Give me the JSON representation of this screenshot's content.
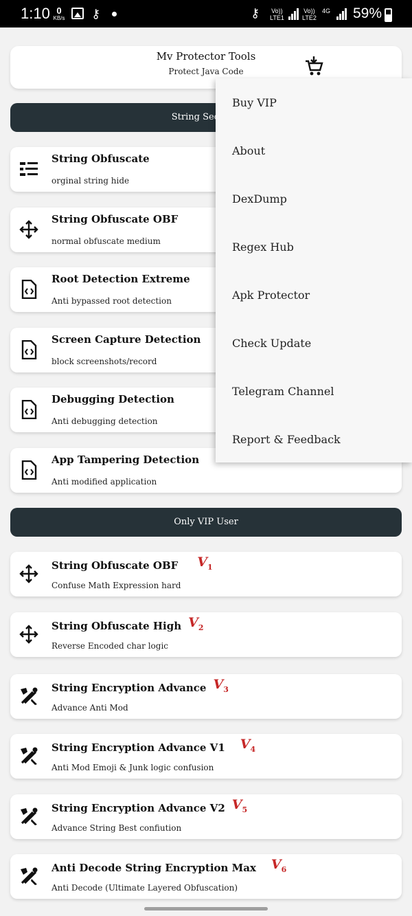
{
  "status_bar": {
    "time": "1:10",
    "speed_value": "0",
    "speed_unit": "KB/s",
    "sim1_top": "Vo))",
    "sim1_bottom": "LTE1",
    "sim2_top": "Vo))",
    "sim2_bottom": "LTE2",
    "network_type": "4G",
    "battery": "59%"
  },
  "header": {
    "title": "Mv Protector Tools",
    "subtitle": "Protect Java Code",
    "cart_icon": "cart-download-icon"
  },
  "sections": {
    "string_security": "String Security",
    "vip": "Only VIP User"
  },
  "features": [
    {
      "title": "String Obfuscate",
      "desc": "orginal string hide",
      "icon": "list-icon"
    },
    {
      "title": "String Obfuscate OBF",
      "desc": "normal obfuscate medium",
      "icon": "move-arrows-icon"
    },
    {
      "title": "Root Detection Extreme",
      "desc": "Anti bypassed root detection",
      "icon": "code-file-icon"
    },
    {
      "title": "Screen Capture Detection",
      "desc": "block screenshots/record",
      "icon": "code-file-icon"
    },
    {
      "title": "Debugging Detection",
      "desc": "Anti debugging detection",
      "icon": "code-file-icon"
    },
    {
      "title": "App Tampering Detection",
      "desc": "Anti modified application",
      "icon": "code-file-icon"
    }
  ],
  "vip_features": [
    {
      "title": "String Obfuscate OBF",
      "desc": "Confuse Math Expression hard",
      "icon": "move-arrows-icon",
      "badge": "V",
      "badge_num": "1"
    },
    {
      "title": "String Obfuscate High",
      "desc": "Reverse Encoded char logic",
      "icon": "move-arrows-icon",
      "badge": "V",
      "badge_num": "2"
    },
    {
      "title": "String Encryption Advance",
      "desc": "Advance Anti Mod",
      "icon": "tools-icon",
      "badge": "V",
      "badge_num": "3"
    },
    {
      "title": "String Encryption Advance V1",
      "desc": "Anti Mod Emoji & Junk logic confusion",
      "icon": "tools-icon",
      "badge": "V",
      "badge_num": "4"
    },
    {
      "title": "String Encryption Advance V2",
      "desc": "Advance String Best confiution",
      "icon": "tools-icon",
      "badge": "V",
      "badge_num": "5"
    },
    {
      "title": "Anti Decode String Encryption Max",
      "desc": "Anti Decode (Ultimate Layered Obfuscation)",
      "icon": "tools-icon",
      "badge": "V",
      "badge_num": "6"
    }
  ],
  "menu": {
    "items": [
      "Buy VIP",
      "About",
      "DexDump",
      "Regex Hub",
      "Apk Protector",
      "Check Update",
      "Telegram Channel",
      "Report & Feedback"
    ]
  },
  "colors": {
    "section_bg": "#263238",
    "badge": "#c62828",
    "page_bg": "#f2f2f2"
  }
}
